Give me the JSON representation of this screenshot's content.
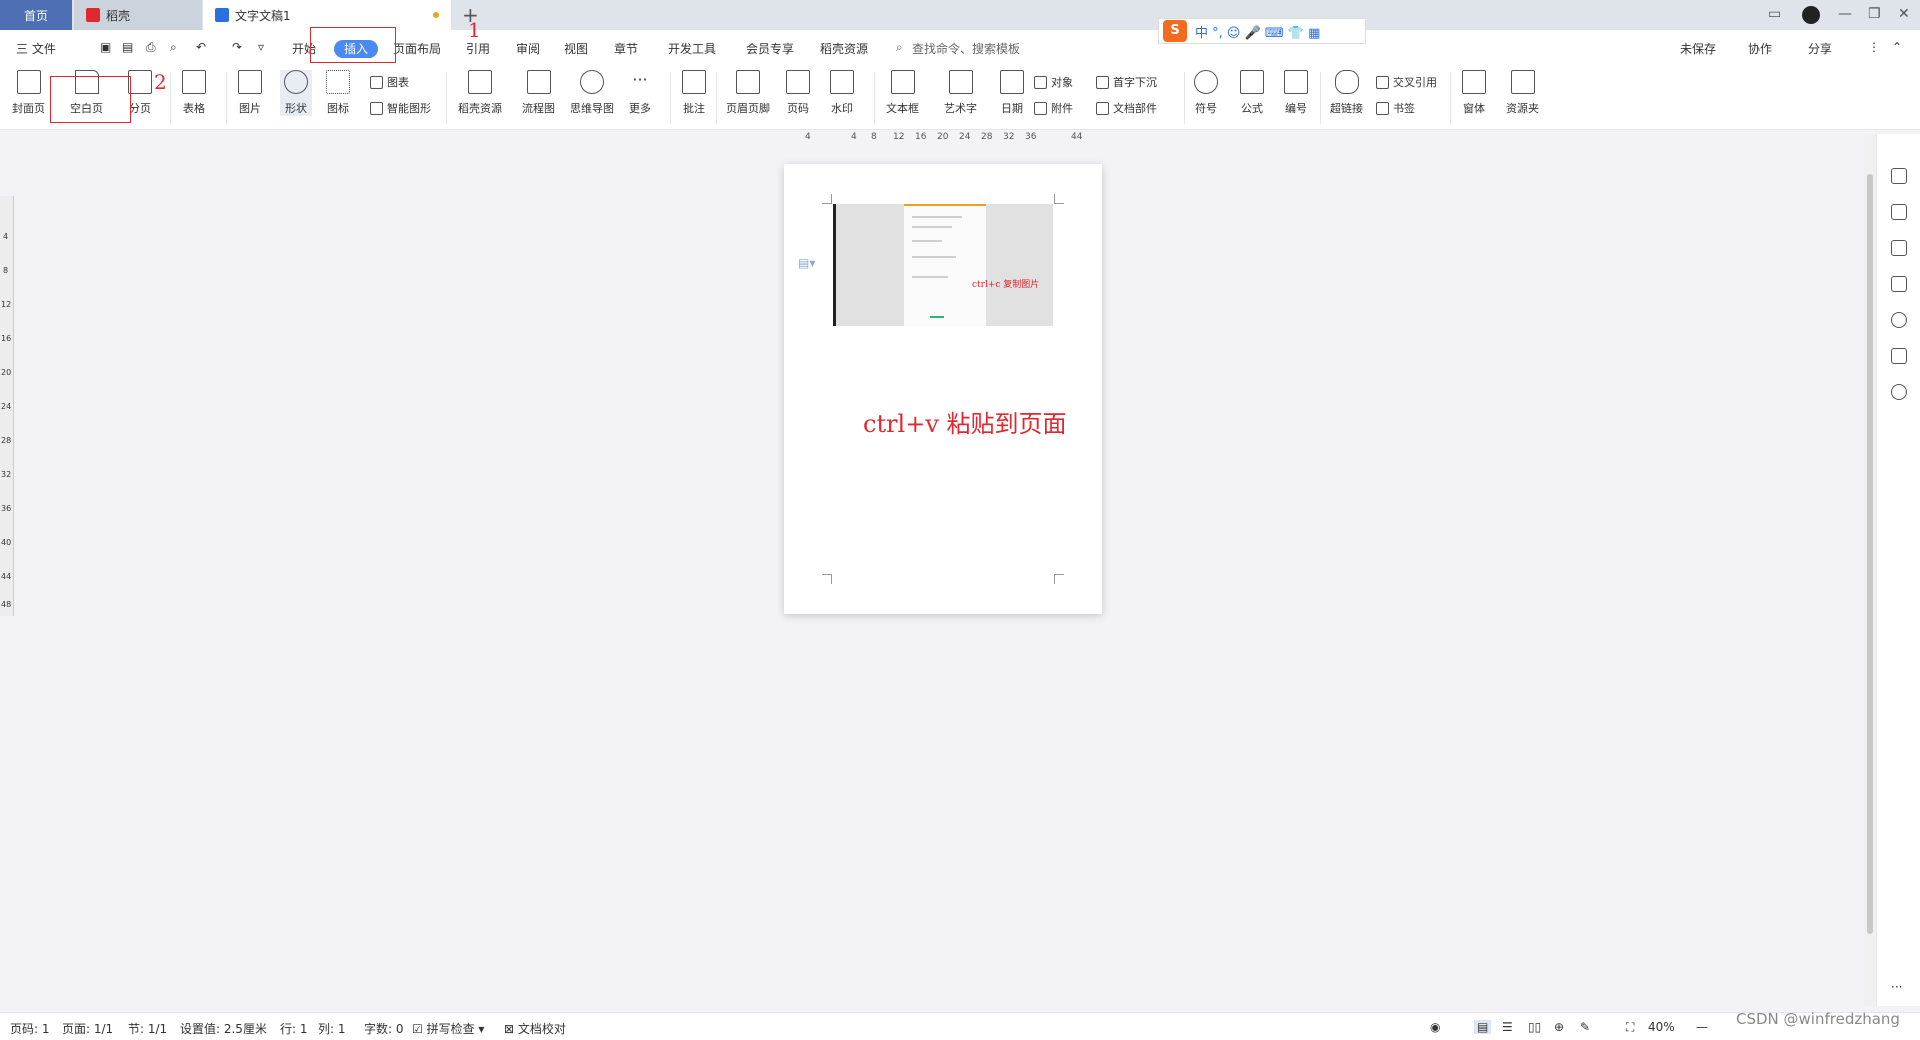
{
  "tabs": {
    "home": "首页",
    "daoke": "稻壳",
    "doc": "文字文稿1",
    "new_tab": "+"
  },
  "menu": {
    "file": "三 文件",
    "items": [
      "开始",
      "插入",
      "页面布局",
      "引用",
      "审阅",
      "视图",
      "章节",
      "开发工具",
      "会员专享",
      "稻壳资源"
    ],
    "search": "查找命令、搜索模板",
    "unsaved": "未保存",
    "collab": "协作",
    "share": "分享"
  },
  "ribbon": {
    "cover": "封面页",
    "blank_page": "空白页",
    "page_break": "分页",
    "table": "表格",
    "picture": "图片",
    "shape": "形状",
    "icon": "图标",
    "chart": "图表",
    "smart_shape": "智能图形",
    "daoke_res": "稻壳资源",
    "flowchart": "流程图",
    "mindmap": "思维导图",
    "more": "更多",
    "comment": "批注",
    "header_footer": "页眉页脚",
    "page_num": "页码",
    "watermark": "水印",
    "textbox": "文本框",
    "wordart": "艺术字",
    "date": "日期",
    "object": "对象",
    "attachment": "附件",
    "dropcap": "首字下沉",
    "doc_parts": "文档部件",
    "symbol": "符号",
    "formula": "公式",
    "numbering": "编号",
    "hyperlink": "超链接",
    "cross_ref": "交叉引用",
    "bookmark": "书签",
    "font_style": "窗体",
    "resource": "资源夹"
  },
  "annotations": {
    "step1": "1",
    "step2": "2"
  },
  "ime": {
    "logo": "S",
    "chars": "中 °, ☺ 🎤 ⌨ 👕 ▦"
  },
  "ruler": [
    "4",
    "4",
    "8",
    "12",
    "16",
    "20",
    "24",
    "28",
    "32",
    "36",
    "44"
  ],
  "vruler": [
    "4",
    "8",
    "12",
    "16",
    "20",
    "24",
    "28",
    "32",
    "36",
    "40",
    "44",
    "48"
  ],
  "page": {
    "pic_caption": "ctrl+c 复制图片",
    "paste_text": "ctrl+v 粘贴到页面"
  },
  "status": {
    "page_code": "页码: 1",
    "pages": "页面: 1/1",
    "section": "节: 1/1",
    "setting": "设置值: 2.5厘米",
    "row": "行: 1",
    "col": "列: 1",
    "words": "字数: 0",
    "spell": "拼写检查",
    "proof": "文档校对",
    "zoom": "40%"
  },
  "watermark": "CSDN @winfredzhang"
}
